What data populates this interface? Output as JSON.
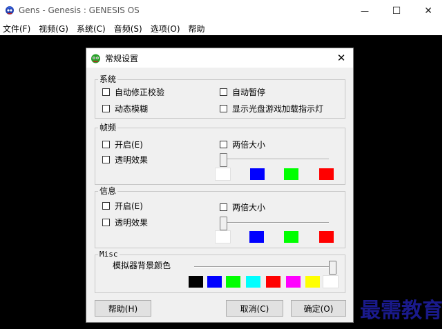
{
  "window": {
    "title": "Gens - Genesis : GENESIS OS",
    "minimize_glyph": "—",
    "maximize_glyph": "☐",
    "close_glyph": "✕"
  },
  "menu": [
    "文件(F)",
    "视频(G)",
    "系统(C)",
    "音频(S)",
    "选项(O)",
    "帮助"
  ],
  "dialog": {
    "title": "常规设置",
    "close_glyph": "✕",
    "system_group": {
      "label": "系统",
      "auto_fix_checksum": "自动修正校验",
      "auto_pause": "自动暂停",
      "motion_blur": "动态模糊",
      "show_cd_led": "显示光盘游戏加载指示灯"
    },
    "fps_group": {
      "label": "帧频",
      "enable": "开启(E)",
      "double_size": "两倍大小",
      "transparency": "透明效果",
      "slider_value": 0,
      "colors": [
        "#ffffff",
        "#0000ff",
        "#00ff00",
        "#ff0000"
      ]
    },
    "info_group": {
      "label": "信息",
      "enable": "开启(E)",
      "double_size": "两倍大小",
      "transparency": "透明效果",
      "slider_value": 0,
      "colors": [
        "#ffffff",
        "#0000ff",
        "#00ff00",
        "#ff0000"
      ]
    },
    "misc_group": {
      "label": "Misc",
      "bg_color_label": "模拟器背景颜色",
      "slider_value": 1,
      "colors": [
        "#000000",
        "#0000ff",
        "#00ff00",
        "#00ffff",
        "#ff0000",
        "#ff00ff",
        "#ffff00",
        "#ffffff"
      ]
    },
    "help_button": "帮助(H)",
    "cancel_button": "取消(C)",
    "ok_button": "确定(O)"
  },
  "watermark": "最需教育"
}
